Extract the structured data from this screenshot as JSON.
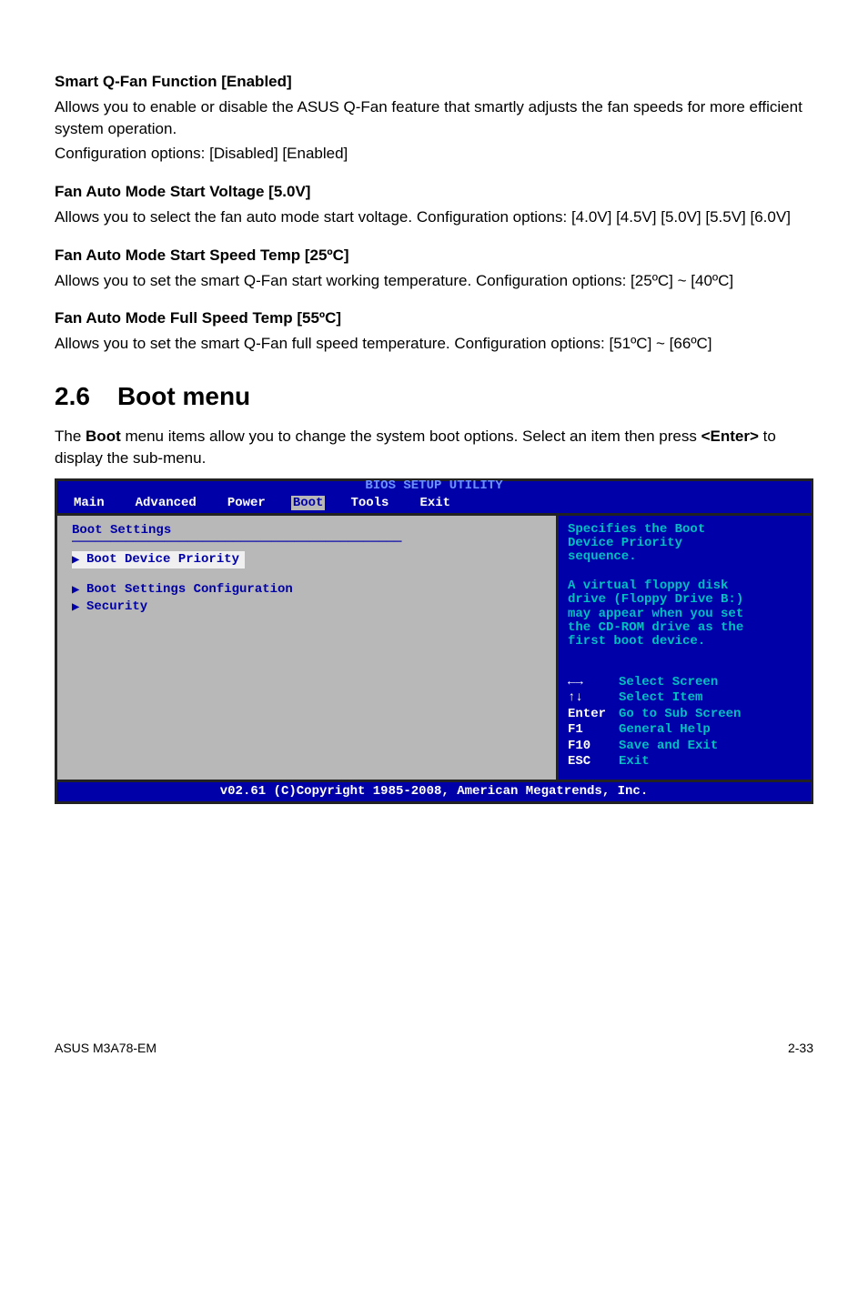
{
  "sections": {
    "qfan": {
      "heading": "Smart Q-Fan Function [Enabled]",
      "body1": "Allows you to enable or disable the ASUS Q-Fan feature that smartly adjusts the fan speeds for more efficient system operation.",
      "body2": "Configuration options: [Disabled] [Enabled]"
    },
    "startVoltage": {
      "heading": "Fan Auto Mode Start Voltage [5.0V]",
      "body": "Allows you to select the fan auto mode start voltage. Configuration options: [4.0V] [4.5V] [5.0V] [5.5V] [6.0V]"
    },
    "startTemp": {
      "heading": "Fan Auto Mode Start Speed Temp [25ºC]",
      "body": "Allows you to set the smart Q-Fan start working temperature. Configuration options: [25ºC] ~ [40ºC]"
    },
    "fullTemp": {
      "heading": "Fan Auto Mode Full Speed Temp [55ºC]",
      "body": "Allows you to set the smart Q-Fan full speed temperature. Configuration options: [51ºC] ~ [66ºC]"
    }
  },
  "chapter": {
    "num": "2.6",
    "title": "Boot menu",
    "intro_pre": "The ",
    "intro_bold": "Boot",
    "intro_mid": " menu items allow you to change the system boot options. Select an item then press ",
    "intro_bold2": "<Enter>",
    "intro_post": " to display the sub-menu."
  },
  "bios": {
    "title": "BIOS SETUP UTILITY",
    "tabs": [
      "Main",
      "Advanced",
      "Power",
      "Boot",
      "Tools",
      "Exit"
    ],
    "left": {
      "heading": "Boot Settings",
      "item_selected": "Boot Device Priority",
      "item2": "Boot Settings Configuration",
      "item3": "Security"
    },
    "right": {
      "hint1": "Specifies the Boot",
      "hint2": "Device Priority",
      "hint3": "sequence.",
      "block1": "A virtual floppy disk",
      "block2": "drive (Floppy Drive B:)",
      "block3": "may appear when you set",
      "block4": "the CD-ROM drive as the",
      "block5": "first boot device.",
      "keys": {
        "lr_label": "Select Screen",
        "ud_label": "Select Item",
        "enter_key": "Enter",
        "enter_label": "Go to Sub Screen",
        "f1_key": "F1",
        "f1_label": "General Help",
        "f10_key": "F10",
        "f10_label": "Save and Exit",
        "esc_key": "ESC",
        "esc_label": "Exit"
      }
    },
    "footer": "v02.61 (C)Copyright 1985-2008, American Megatrends, Inc."
  },
  "pageFooter": {
    "left": "ASUS M3A78-EM",
    "right": "2-33"
  }
}
